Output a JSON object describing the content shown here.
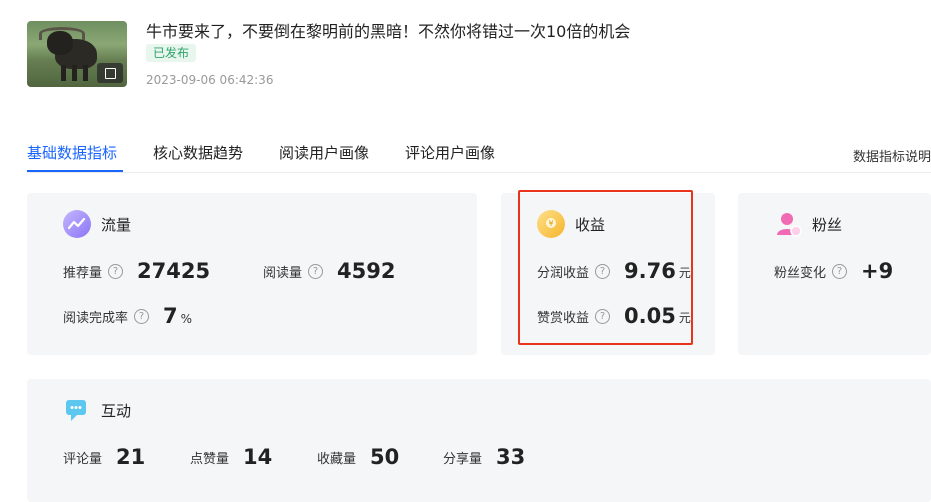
{
  "article": {
    "title": "牛市要来了，不要倒在黎明前的黑暗！不然你将错过一次10倍的机会",
    "status": "已发布",
    "timestamp": "2023-09-06 06:42:36"
  },
  "tabs": [
    {
      "label": "基础数据指标",
      "active": true
    },
    {
      "label": "核心数据趋势",
      "active": false
    },
    {
      "label": "阅读用户画像",
      "active": false
    },
    {
      "label": "评论用户画像",
      "active": false
    }
  ],
  "explain_link": "数据指标说明",
  "traffic": {
    "title": "流量",
    "icon": "traffic-icon",
    "metrics": [
      {
        "label": "推荐量",
        "value": "27425"
      },
      {
        "label": "阅读量",
        "value": "4592"
      },
      {
        "label": "阅读完成率",
        "value": "7",
        "unit": "%"
      }
    ]
  },
  "revenue": {
    "title": "收益",
    "icon": "coin-hand-icon",
    "metrics": [
      {
        "label": "分润收益",
        "value": "9.76",
        "unit": "元"
      },
      {
        "label": "赞赏收益",
        "value": "0.05",
        "unit": "元"
      }
    ]
  },
  "fans": {
    "title": "粉丝",
    "icon": "user-icon",
    "metrics": [
      {
        "label": "粉丝变化",
        "value": "+9"
      }
    ]
  },
  "interaction": {
    "title": "互动",
    "icon": "chat-icon",
    "metrics": [
      {
        "label": "评论量",
        "value": "21"
      },
      {
        "label": "点赞量",
        "value": "14"
      },
      {
        "label": "收藏量",
        "value": "50"
      },
      {
        "label": "分享量",
        "value": "33"
      }
    ]
  },
  "colors": {
    "accent": "#1966ff",
    "status_green": "#2ea36b",
    "highlight_red": "#e8341c",
    "card_bg": "#f5f6f8"
  }
}
